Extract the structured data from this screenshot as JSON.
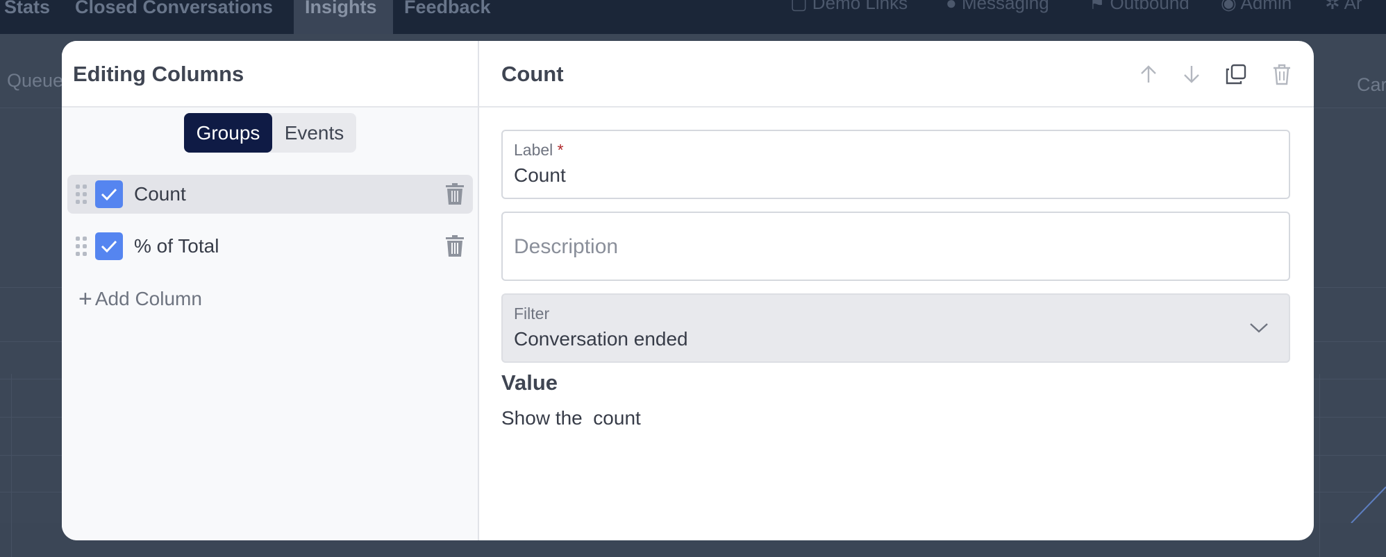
{
  "background": {
    "nav_tabs": [
      {
        "label": "Stats"
      },
      {
        "label": "Closed Conversations"
      },
      {
        "label": "Insights"
      },
      {
        "label": "Feedback"
      }
    ],
    "right_nav": [
      {
        "label": "Demo Links"
      },
      {
        "label": "Messaging"
      },
      {
        "label": "Outbound"
      },
      {
        "label": "Admin"
      },
      {
        "label": "Ar"
      }
    ],
    "left_text": "Queue",
    "right_text": "Car"
  },
  "modal": {
    "left": {
      "title": "Editing Columns",
      "tabs": [
        {
          "label": "Groups",
          "active": true
        },
        {
          "label": "Events",
          "active": false
        }
      ],
      "columns": [
        {
          "name": "Count",
          "checked": true,
          "selected": true
        },
        {
          "name": "% of Total",
          "checked": true,
          "selected": false
        }
      ],
      "add_column_label": "Add Column"
    },
    "right": {
      "title": "Count",
      "label_field": {
        "label": "Label",
        "required_mark": "*",
        "value": "Count"
      },
      "description_field": {
        "placeholder": "Description"
      },
      "filter_field": {
        "label": "Filter",
        "value": "Conversation ended"
      },
      "value_heading": "Value",
      "value_text": "Show the  count"
    }
  },
  "colors": {
    "accent_dark": "#0f1b45",
    "checkbox": "#5585f0",
    "required": "#b0282b"
  }
}
